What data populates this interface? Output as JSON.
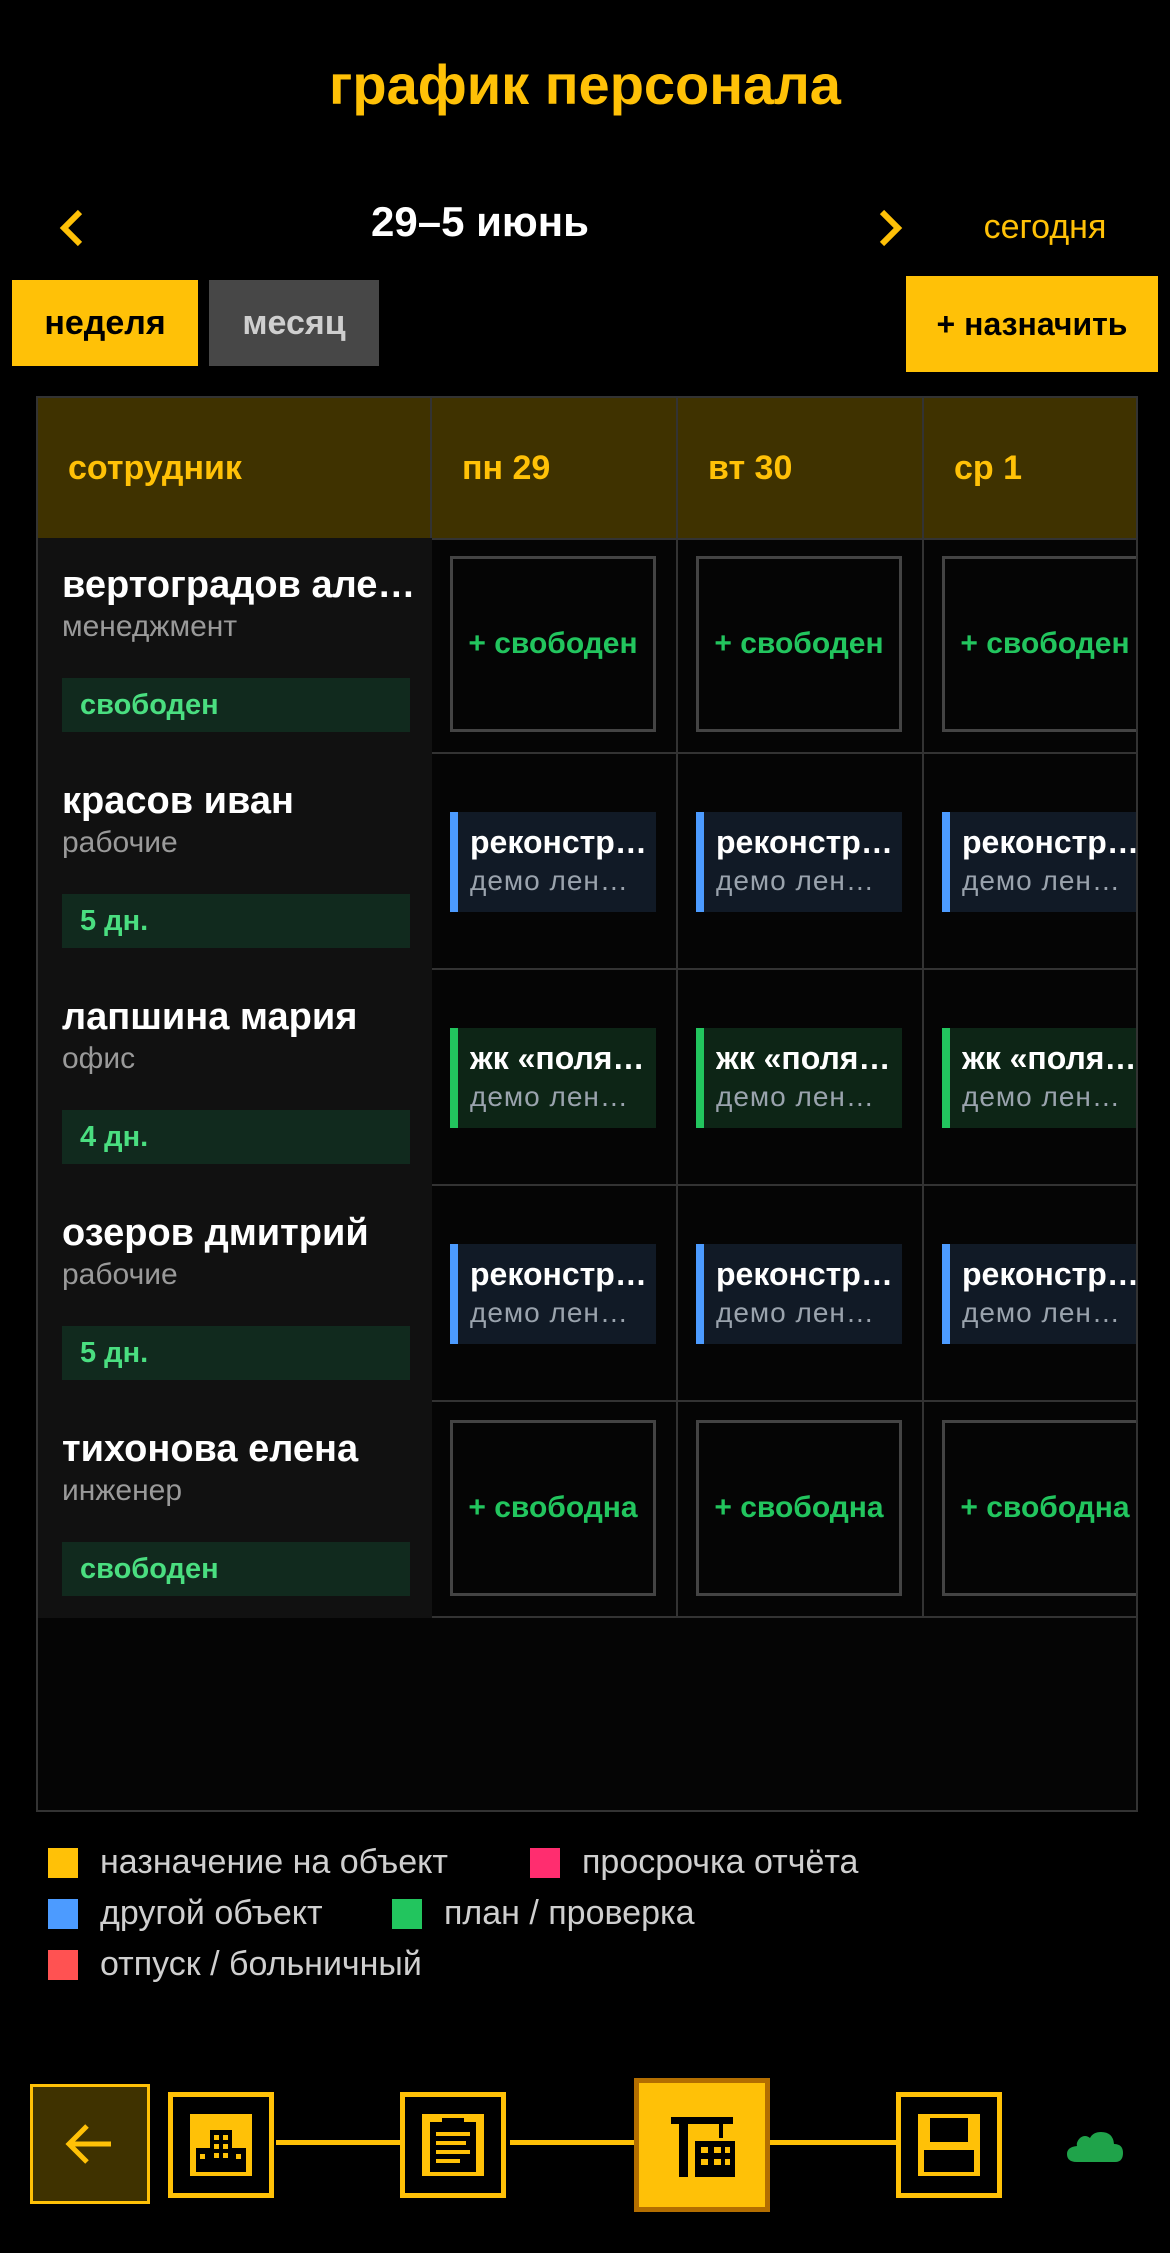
{
  "header": {
    "title": "график персонала"
  },
  "date_nav": {
    "range": "29–5 июнь",
    "today": "сегодня"
  },
  "view": {
    "week": "неделя",
    "month": "месяц",
    "assign": "+ назначить"
  },
  "table": {
    "columns": [
      "сотрудник",
      "пн 29",
      "вт 30",
      "ср 1"
    ],
    "rows": [
      {
        "name": "вертоградов але…",
        "dept": "менеджмент",
        "badge": "свободен",
        "cells": [
          {
            "type": "free",
            "label": "+ свободен"
          },
          {
            "type": "free",
            "label": "+ свободен"
          },
          {
            "type": "free",
            "label": "+ свободен"
          }
        ]
      },
      {
        "name": "красов иван",
        "dept": "рабочие",
        "badge": "5 дн.",
        "cells": [
          {
            "type": "blue",
            "title": "реконстр…",
            "sub": "демо лен…"
          },
          {
            "type": "blue",
            "title": "реконстр…",
            "sub": "демо лен…"
          },
          {
            "type": "blue",
            "title": "реконстр…",
            "sub": "демо лен…"
          }
        ]
      },
      {
        "name": "лапшина мария",
        "dept": "офис",
        "badge": "4 дн.",
        "cells": [
          {
            "type": "green",
            "title": "жк «поля…",
            "sub": "демо лен…"
          },
          {
            "type": "green",
            "title": "жк «поля…",
            "sub": "демо лен…"
          },
          {
            "type": "green",
            "title": "жк «поля…",
            "sub": "демо лен…"
          }
        ]
      },
      {
        "name": "озеров дмитрий",
        "dept": "рабочие",
        "badge": "5 дн.",
        "cells": [
          {
            "type": "blue",
            "title": "реконстр…",
            "sub": "демо лен…"
          },
          {
            "type": "blue",
            "title": "реконстр…",
            "sub": "демо лен…"
          },
          {
            "type": "blue",
            "title": "реконстр…",
            "sub": "демо лен…"
          }
        ]
      },
      {
        "name": "тихонова елена",
        "dept": "инженер",
        "badge": "свободен",
        "cells": [
          {
            "type": "free",
            "label": "+ свободна"
          },
          {
            "type": "free",
            "label": "+ свободна"
          },
          {
            "type": "free",
            "label": "+ свободна"
          }
        ]
      }
    ]
  },
  "legend": [
    {
      "label": "назначение на объект",
      "color": "#FFC107"
    },
    {
      "label": "просрочка отчёта",
      "color": "#FF2D6F"
    },
    {
      "label": "другой объект",
      "color": "#4C9BFF"
    },
    {
      "label": "план / проверка",
      "color": "#22C55E"
    },
    {
      "label": "отпуск / больничный",
      "color": "#FF5252"
    }
  ],
  "bottom_nav": {
    "items": [
      "back-arrow-icon",
      "building-icon",
      "clipboard-icon",
      "crane-icon",
      "floppy-disk-icon",
      "cloud-icon"
    ],
    "active": "crane-icon"
  },
  "colors": {
    "accent": "#FFC107",
    "free": "#22C55E",
    "background": "#000000"
  }
}
